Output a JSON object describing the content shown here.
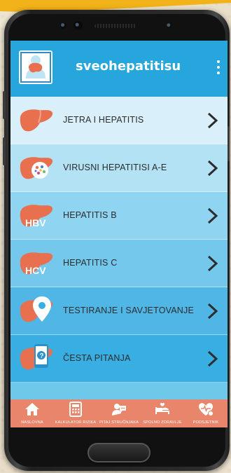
{
  "app": {
    "title": "sveohepatitisu"
  },
  "menu": [
    {
      "label": "JETRA I HEPATITIS",
      "icon": "liver-icon",
      "bg": "#d9f0fa"
    },
    {
      "label": "VIRUSNI HEPATITISI A-E",
      "icon": "liver-virus-icon",
      "bg": "#b3e2f5"
    },
    {
      "label": "HEPATITIS B",
      "icon": "liver-hbv-icon",
      "bg": "#8fd4f0"
    },
    {
      "label": "HEPATITIS C",
      "icon": "liver-hcv-icon",
      "bg": "#73c8ec"
    },
    {
      "label": "TESTIRANJE I SAVJETOVANJE",
      "icon": "liver-location-icon",
      "bg": "#4fb6e6"
    },
    {
      "label": "ČESTA PITANJA",
      "icon": "liver-question-icon",
      "bg": "#38aee2"
    }
  ],
  "badges": {
    "hbv": "HBV",
    "hcv": "HCV"
  },
  "bottom_nav": [
    {
      "label": "NASLOVNA",
      "icon": "home-icon"
    },
    {
      "label": "KALKULATOR RIZIKA",
      "icon": "calculator-icon"
    },
    {
      "label": "PITAJ STRUČNJAKA",
      "icon": "ask-expert-icon"
    },
    {
      "label": "SPOLNO ZDRAVLJE",
      "icon": "bed-icon"
    },
    {
      "label": "PODSJETNIK",
      "icon": "heart-reminder-icon"
    }
  ],
  "colors": {
    "appbar": "#27a6de",
    "liver": "#e8704f",
    "bottom_nav": "#e8856b"
  }
}
